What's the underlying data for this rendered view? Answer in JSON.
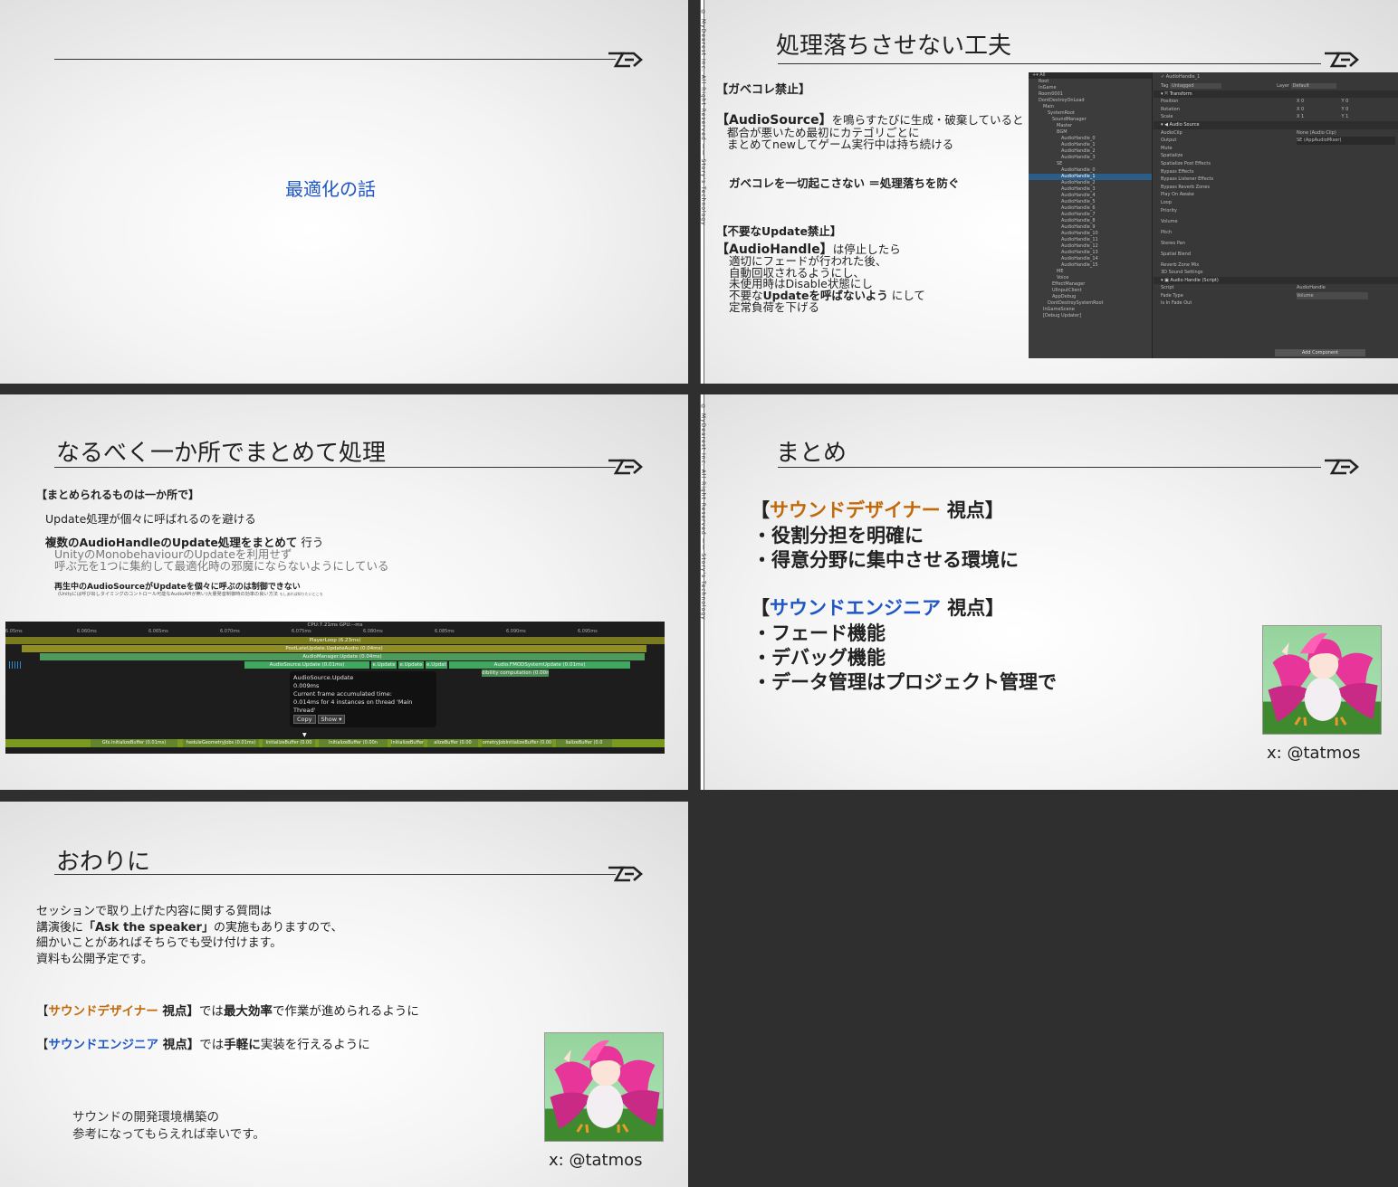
{
  "slide1": {
    "title": "最適化の話"
  },
  "vertical_text": "© MyDearest Inc. All Right Reserved —— Story's Technology",
  "slide2": {
    "title": "処理落ちさせない工夫",
    "gc_heading": "【ガベコレ禁止】",
    "gc_line1_bold": "【AudioSource】",
    "gc_line1": "を鳴らすたびに生成・破棄していると",
    "gc_line2": "都合が悪いため最初にカテゴリごとに",
    "gc_line3": "まとめてnewしてゲーム実行中は持ち続ける",
    "gc_summary": "ガベコレを一切起こさない ＝処理落ちを防ぐ",
    "update_heading": "【不要なUpdate禁止】",
    "upd_line1_bold": "【AudioHandle】",
    "upd_line1": "は停止したら",
    "upd_line2": "適切にフェードが行われた後、",
    "upd_line3": "自動回収されるようにし、",
    "upd_line4": "未使用時はDisable状態にし",
    "upd_line5_a": "不要な",
    "upd_line5_bold": "Updateを呼ばないよう",
    "upd_line5_b": "にして",
    "upd_line6": "定常負荷を下げる",
    "unity": {
      "search": "All",
      "hierarchy": [
        "Root",
        "InGame",
        "Room0001",
        "DontDestroyOnLoad",
        "Main",
        "SystemRoot",
        "SoundManager",
        "Master",
        "BGM",
        "AudioHandle_0",
        "AudioHandle_1",
        "AudioHandle_2",
        "AudioHandle_3",
        "SE",
        "AudioHandle_0",
        "AudioHandle_1",
        "AudioHandle_2",
        "AudioHandle_3",
        "AudioHandle_4",
        "AudioHandle_5",
        "AudioHandle_6",
        "AudioHandle_7",
        "AudioHandle_8",
        "AudioHandle_9",
        "AudioHandle_10",
        "AudioHandle_11",
        "AudioHandle_12",
        "AudioHandle_13",
        "AudioHandle_14",
        "AudioHandle_15",
        "ME",
        "Voice",
        "EffectManager",
        "UIInputClient",
        "AppDebug",
        "DontDestroySystemRoot",
        "InGameScene",
        "[Debug Updater]"
      ],
      "object_name": "AudioHandle_1",
      "tag_label": "Tag",
      "tag_value": "Untagged",
      "layer_label": "Layer",
      "layer_value": "Default",
      "transform": "Transform",
      "position": "Position",
      "rotation": "Rotation",
      "scale": "Scale",
      "audio_source": "Audio Source",
      "audioclip": "AudioClip",
      "audioclip_value": "None (Audio Clip)",
      "output": "Output",
      "output_value": "SE (AppAudioMixer)",
      "props": [
        "Mute",
        "Spatialize",
        "Spatialize Post Effects",
        "Bypass Effects",
        "Bypass Listener Effects",
        "Bypass Reverb Zones",
        "Play On Awake",
        "Loop",
        "Priority",
        "Volume",
        "Pitch",
        "Stereo Pan",
        "Spatial Blend",
        "Reverb Zone Mix",
        "3D Sound Settings"
      ],
      "script_header": "Audio Handle (Script)",
      "script_label": "Script",
      "script_value": "AudioHandle",
      "fade_type": "Fade Type",
      "fade_type_value": "Volume",
      "is_fade_out": "Is In Fade Out",
      "add_component": "Add Component"
    }
  },
  "slide3": {
    "title": "なるべく一か所でまとめて処理",
    "heading": "【まとめられるものは一か所で】",
    "line1": "Update処理が個々に呼ばれるのを避ける",
    "line2_bold": "複数のAudioHandleのUpdate処理をまとめて",
    "line2": "行う",
    "line3": "UnityのMonobehaviourのUpdateを利用せず",
    "line4": "呼ぶ元を1つに集約して最適化時の邪魔にならないようにしている",
    "note_bold": "再生中のAudioSourceがUpdateを個々に呼ぶのは制御できない",
    "note_small": "(Unityには呼び出しタイミングのコントロール可能なAudioAPIが無い)大量発音制御時の効率の良い方法",
    "note_tiny": "もしあれば知りたいところ",
    "profiler": {
      "header": "CPU:7.21ms   GPU:--ms",
      "ticks": [
        "6.05ms",
        "6.060ms",
        "6.065ms",
        "6.070ms",
        "6.075ms",
        "6.080ms",
        "6.085ms",
        "6.090ms",
        "6.095ms"
      ],
      "playerloop": "PlayerLoop (6.23ms)",
      "postlate": "PostLateUpdate.UpdateAudio (0.04ms)",
      "audiomanager": "AudioManager.Update (0.04ms)",
      "audiosource": "AudioSource.Update (0.01ms)",
      "source2": "e.Update",
      "source3": "e.Update",
      "source4": "e.Updat",
      "fmod": "Audio.FMODSystemUpdate (0.01ms)",
      "audibility": "dibility computation (0.00n",
      "tooltip_title": "AudioSource.Update",
      "tooltip_time": "0.009ms",
      "tooltip_accum": "Current frame accumulated time:",
      "tooltip_detail": "0.014ms for 4 instances on thread 'Main Thread'",
      "copy": "Copy",
      "show": "Show ▾",
      "bottom_bars": [
        "Gfx.InitializeBuffer (0.01ms)",
        "heduleGeometryJobs (0.01ms)",
        "InitializeBuffer (0.00",
        "InitializeBuffer (0.00n",
        "InitializeBuffer (0.00",
        "alizeBuffer (0.00",
        "ometryJobInitializeBuffer (0.00",
        "lializeBuffer (0.0"
      ]
    }
  },
  "slide4": {
    "title": "まとめ",
    "d_open": "【",
    "d_role": "サウンドデザイナー",
    "d_close": " 視点】",
    "d_items": [
      "・役割分担を明確に",
      "・得意分野に集中させる環境に"
    ],
    "e_open": "【",
    "e_role": "サウンドエンジニア",
    "e_close": " 視点】",
    "e_items": [
      "・フェード機能",
      "・デバッグ機能",
      "・データ管理はプロジェクト管理で"
    ],
    "credit": "x: @tatmos"
  },
  "slide5": {
    "title": "おわりに",
    "p1": "セッションで取り上げた内容に関する質問は",
    "p2_a": "講演後に",
    "p2_bold": "「Ask the speaker」",
    "p2_b": "の実施もありますので、",
    "p3": "細かいことがあればそちらでも受け付けます。",
    "p4": "資料も公開予定です。",
    "d_open": "【",
    "d_role": "サウンドデザイナー",
    "d_close": " 視点】",
    "d_a": "では",
    "d_bold": "最大効率",
    "d_b": "で作業が進められるように",
    "e_open": "【",
    "e_role": "サウンドエンジニア",
    "e_close": " 視点】",
    "e_a": "では",
    "e_bold": "手軽に",
    "e_b": "実装を行えるように",
    "c1": "サウンドの開発環境構築の",
    "c2": "参考になってもらえれば幸いです。",
    "credit": "x: @tatmos"
  },
  "colors": {
    "designer": "#c2690a",
    "engineer": "#1f57c7",
    "background": "#2f2f2f"
  }
}
